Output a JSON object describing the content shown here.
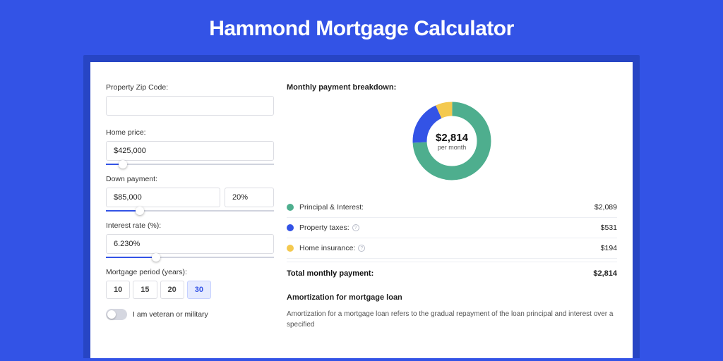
{
  "page_title": "Hammond Mortgage Calculator",
  "form": {
    "zip_label": "Property Zip Code:",
    "zip_value": "",
    "home_price_label": "Home price:",
    "home_price_value": "$425,000",
    "down_payment_label": "Down payment:",
    "down_payment_value": "$85,000",
    "down_payment_pct": "20%",
    "interest_label": "Interest rate (%):",
    "interest_value": "6.230%",
    "period_label": "Mortgage period (years):",
    "periods": [
      "10",
      "15",
      "20",
      "30"
    ],
    "period_active": "30",
    "veteran_label": "I am veteran or military"
  },
  "breakdown": {
    "title": "Monthly payment breakdown:",
    "center_amount": "$2,814",
    "center_sub": "per month",
    "rows": [
      {
        "color": "green",
        "label": "Principal & Interest:",
        "info": false,
        "value": "$2,089"
      },
      {
        "color": "blue",
        "label": "Property taxes:",
        "info": true,
        "value": "$531"
      },
      {
        "color": "yellow",
        "label": "Home insurance:",
        "info": true,
        "value": "$194"
      }
    ],
    "total_label": "Total monthly payment:",
    "total_value": "$2,814"
  },
  "amortization": {
    "title": "Amortization for mortgage loan",
    "body": "Amortization for a mortgage loan refers to the gradual repayment of the loan principal and interest over a specified"
  },
  "chart_data": {
    "type": "pie",
    "title": "Monthly payment breakdown",
    "series": [
      {
        "name": "Principal & Interest",
        "value": 2089,
        "color": "#4eae8e"
      },
      {
        "name": "Property taxes",
        "value": 531,
        "color": "#3353e6"
      },
      {
        "name": "Home insurance",
        "value": 194,
        "color": "#f4c94f"
      }
    ],
    "total": 2814,
    "unit": "USD per month"
  }
}
